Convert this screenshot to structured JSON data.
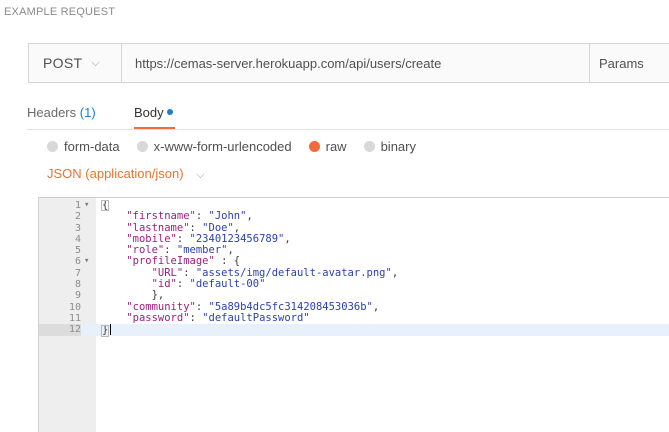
{
  "section_title": "EXAMPLE REQUEST",
  "request": {
    "method": "POST",
    "url": "https://cemas-server.herokuapp.com/api/users/create",
    "params_label": "Params"
  },
  "tabs": {
    "headers_label": "Headers",
    "headers_count": "(1)",
    "body_label": "Body"
  },
  "body_modes": [
    {
      "label": "form-data",
      "selected": false
    },
    {
      "label": "x-www-form-urlencoded",
      "selected": false
    },
    {
      "label": "raw",
      "selected": true
    },
    {
      "label": "binary",
      "selected": false
    }
  ],
  "content_type": "JSON (application/json)",
  "editor": {
    "active_line": 12,
    "lines": [
      {
        "n": "1",
        "fold": true,
        "text": "{"
      },
      {
        "n": "2",
        "fold": false,
        "text": "\t\"firstname\": \"John\","
      },
      {
        "n": "3",
        "fold": false,
        "text": "\t\"lastname\": \"Doe\","
      },
      {
        "n": "4",
        "fold": false,
        "text": "\t\"mobile\": \"2340123456789\","
      },
      {
        "n": "5",
        "fold": false,
        "text": "\t\"role\": \"member\","
      },
      {
        "n": "6",
        "fold": true,
        "text": "\t\"profileImage\" : {"
      },
      {
        "n": "7",
        "fold": false,
        "text": "\t\t\"URL\": \"assets/img/default-avatar.png\","
      },
      {
        "n": "8",
        "fold": false,
        "text": "\t\t\"id\": \"default-00\""
      },
      {
        "n": "9",
        "fold": false,
        "text": "\t\t},"
      },
      {
        "n": "10",
        "fold": false,
        "text": "\t\"community\": \"5a89b4dc5fc314208453036b\","
      },
      {
        "n": "11",
        "fold": false,
        "text": "\t\"password\": \"defaultPassword\""
      },
      {
        "n": "12",
        "fold": false,
        "text": "}"
      }
    ]
  },
  "colors": {
    "accent_orange": "#f26b3a",
    "accent_blue": "#1f7bd1",
    "json_key": "#9c1f7c",
    "json_string": "#2c3fb0"
  }
}
